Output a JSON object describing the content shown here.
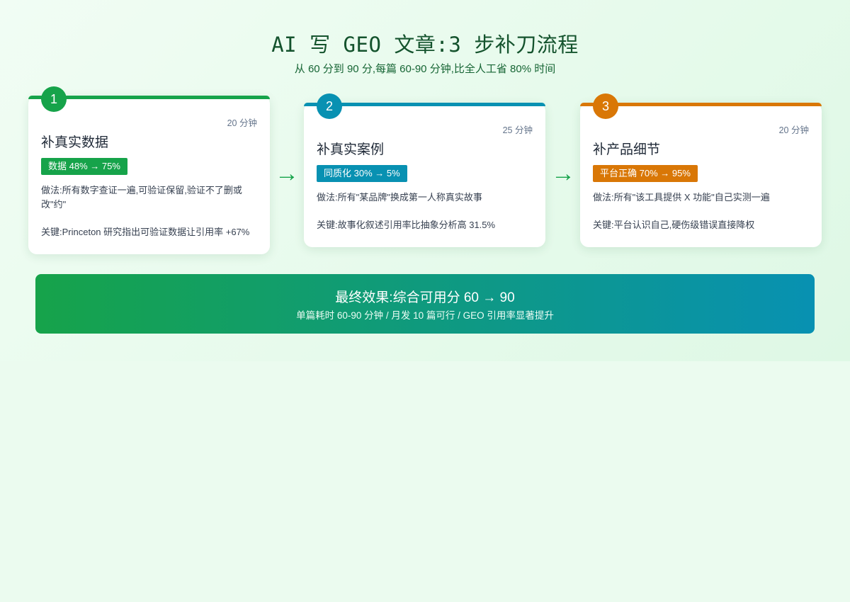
{
  "header": {
    "title": "AI 写 GEO 文章:3 步补刀流程",
    "subtitle": "从 60 分到 90 分,每篇 60-90 分钟,比全人工省 80% 时间"
  },
  "steps": [
    {
      "number": "1",
      "time": "20 分钟",
      "name": "补真实数据",
      "metric": "数据 48% → 75%",
      "method": "做法:所有数字查证一遍,可验证保留,验证不了删或改\"约\"",
      "key": "关键:Princeton 研究指出可验证数据让引用率 +67%",
      "color": "#16a34a"
    },
    {
      "number": "2",
      "time": "25 分钟",
      "name": "补真实案例",
      "metric": "同质化 30% → 5%",
      "method": "做法:所有\"某品牌\"换成第一人称真实故事",
      "key": "关键:故事化叙述引用率比抽象分析高 31.5%",
      "color": "#0891b2"
    },
    {
      "number": "3",
      "time": "20 分钟",
      "name": "补产品细节",
      "metric": "平台正确 70% → 95%",
      "method": "做法:所有\"该工具提供 X 功能\"自己实测一遍",
      "key": "关键:平台认识自己,硬伤级错误直接降权",
      "color": "#d97706"
    }
  ],
  "arrows": [
    "→",
    "→"
  ],
  "result": {
    "title": "最终效果:综合可用分 60 → 90",
    "subtitle": "单篇耗时 60-90 分钟 / 月发 10 篇可行 / GEO 引用率显著提升"
  }
}
